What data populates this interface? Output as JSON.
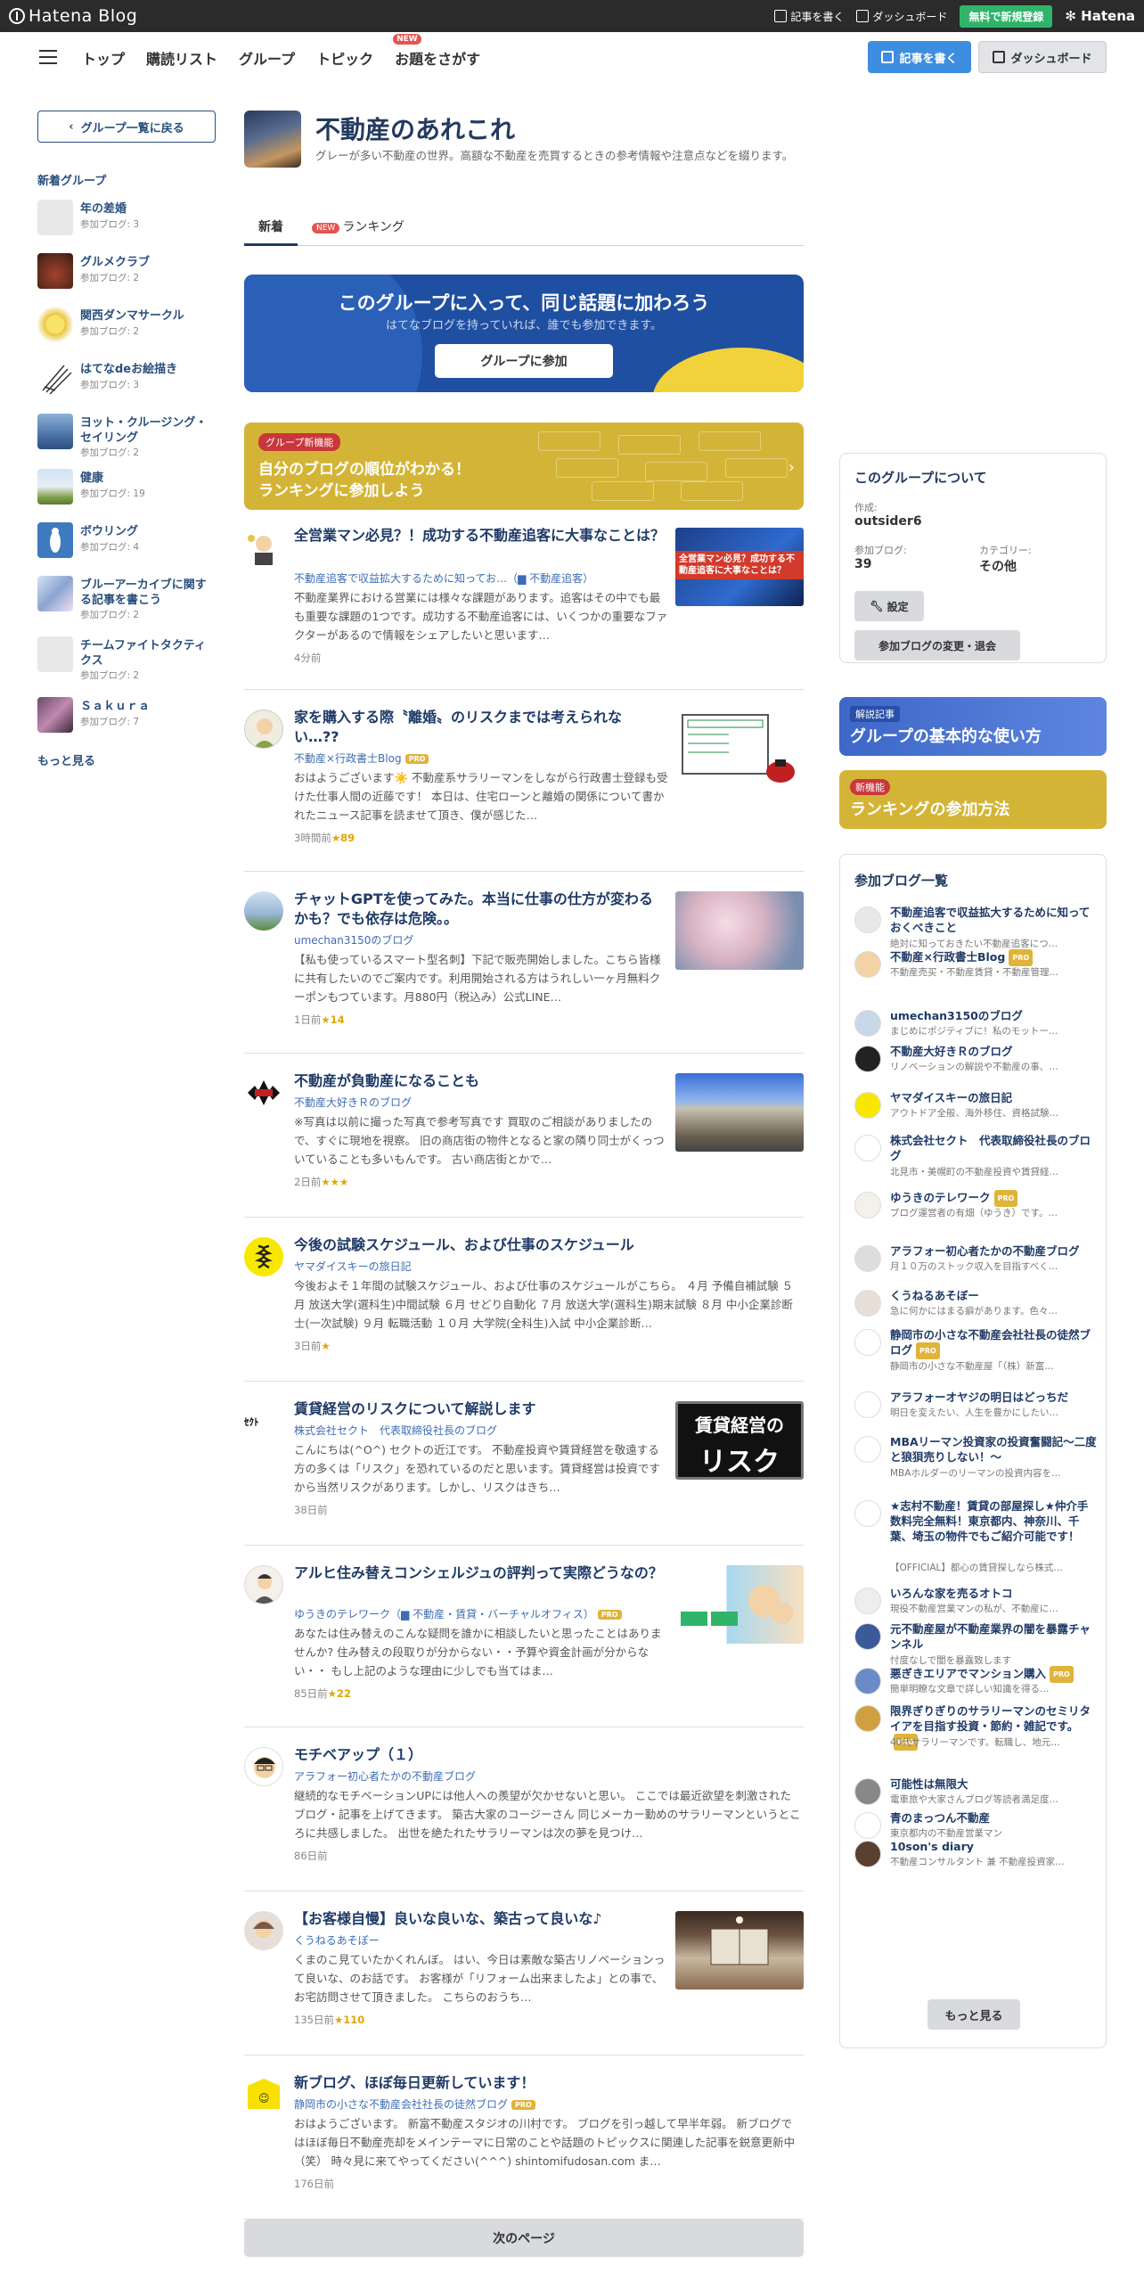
{
  "topbar": {
    "logo": "Hatena Blog",
    "write": "記事を書く",
    "dashboard": "ダッシュボード",
    "signup": "無料で新規登録",
    "hatena": "Hatena"
  },
  "nav": {
    "items": [
      "トップ",
      "購読リスト",
      "グループ",
      "トピック",
      "お題をさがす"
    ],
    "new_badge": "NEW",
    "write_button": "記事を書く",
    "dashboard_button": "ダッシュボード"
  },
  "left": {
    "back": "グループ一覧に戻る",
    "heading": "新着グループ",
    "count_prefix": "参加ブログ: ",
    "more": "もっと見る",
    "groups": [
      {
        "name": "年の差婚",
        "count": "3"
      },
      {
        "name": "グルメクラブ",
        "count": "2"
      },
      {
        "name": "関西ダンマサークル",
        "count": "2"
      },
      {
        "name": "はてなdeお絵描き",
        "count": "3"
      },
      {
        "name": "ヨット・クルージング・セイリング",
        "count": "2"
      },
      {
        "name": "健康",
        "count": "19"
      },
      {
        "name": "ボウリング",
        "count": "4"
      },
      {
        "name": "ブルーアーカイブに関する記事を書こう",
        "count": "2"
      },
      {
        "name": "チームファイトタクティクス",
        "count": "2"
      },
      {
        "name": "Ｓａｋｕｒａ",
        "count": "7"
      }
    ]
  },
  "group": {
    "title": "不動産のあれこれ",
    "description": "グレーが多い不動産の世界。高額な不動産を売買するときの参考情報や注意点などを綴ります。"
  },
  "tabs": {
    "latest": "新着",
    "new_badge": "NEW",
    "ranking": "ランキング"
  },
  "join_banner": {
    "title": "このグループに入って、同じ話題に加わろう",
    "subtitle": "はてなブログを持っていれば、誰でも参加できます。",
    "button": "グループに参加"
  },
  "rank_banner": {
    "badge": "グループ新機能",
    "line1": "自分のブログの順位がわかる！",
    "line2": "ランキングに参加しよう"
  },
  "entries": [
    {
      "title": "全営業マン必見？！成功する不動産追客に大事なことは？",
      "blog": "不動産追客で収益拡大するために知ってお…",
      "cat": "不動産追客",
      "pro": false,
      "excerpt": "不動産業界における営業には様々な課題があります。追客はその中でも最も重要な課題の1つです。成功する不動産追客には、いくつかの重要なファクターがあるので情報をシェアしたいと思います…",
      "date": "4分前",
      "stars": ""
    },
    {
      "title": "家を購入する際〝離婚〟のリスクまでは考えられない…??",
      "blog": "不動産×行政書士Blog",
      "cat": "",
      "pro": true,
      "excerpt": "おはようございます☀️ 不動産系サラリーマンをしながら行政書士登録も受けた仕事人間の近藤です！ 本日は、住宅ローンと離婚の関係について書かれたニュース記事を読ませて頂き、僕が感じた…",
      "date": "3時間前",
      "stars": "★89"
    },
    {
      "title": "チャットGPTを使ってみた。本当に仕事の仕方が変わるかも？でも依存は危険。。",
      "blog": "umechan3150のブログ",
      "cat": "",
      "pro": false,
      "excerpt": "【私も使っているスマート型名刺】下記で販売開始しました。こちら皆様に共有したいのでご案内です。利用開始される方はうれしい一ヶ月無料クーポンもつています。月880円（税込み）公式LINE…",
      "date": "1日前",
      "stars": "★14"
    },
    {
      "title": "不動産が負動産になることも",
      "blog": "不動産大好きＲのブログ",
      "cat": "",
      "pro": false,
      "excerpt": "※写真は以前に撮った写真で参考写真です 買取のご相談がありましたので、すぐに現地を視察。 旧の商店街の物件となると家の隣り同士がくっついていることも多いもんです。 古い商店街とかで…",
      "date": "2日前",
      "stars": "★★★"
    },
    {
      "title": "今後の試験スケジュール、および仕事のスケジュール",
      "blog": "ヤマダイスキーの旅日記",
      "cat": "",
      "pro": false,
      "excerpt": "今後およそ１年間の試験スケジュール、および仕事のスケジュールがこちら。 ４月 予備自補試験 ５月 放送大学(選科生)中間試験 ６月 せどり自動化 ７月 放送大学(選科生)期末試験 ８月 中小企業診断士(一次試験) ９月 転職活動 １０月 大学院(全科生)入試 中小企業診断…",
      "date": "3日前",
      "stars": "★"
    },
    {
      "title": "賃貸経営のリスクについて解説します",
      "blog": "株式会社セクト　代表取締役社長のブログ",
      "cat": "",
      "pro": false,
      "excerpt": "こんにちは(^O^) セクトの近江です。 不動産投資や賃貸経営を敬遠する方の多くは「リスク」を恐れているのだと思います。賃貸経営は投資ですから当然リスクがあります。しかし、リスクはきち…",
      "date": "38日前",
      "stars": ""
    },
    {
      "title": "アルヒ住み替えコンシェルジュの評判って実際どうなの？",
      "blog": "ゆうきのテレワーク（",
      "cat": "不動産・賃貸・バーチャルオフィス",
      "pro": true,
      "excerpt": "あなたは住み替えのこんな疑問を誰かに相談したいと思ったことはありませんか? 住み替えの段取りが分からない・・予算や資金計画が分からない・・ もし上記のような理由に少しでも当てはま…",
      "date": "85日前",
      "stars": "★22"
    },
    {
      "title": "モチベアップ（１）",
      "blog": "アラフォー初心者たかの不動産ブログ",
      "cat": "",
      "pro": false,
      "excerpt": "継続的なモチベーションUPには他人への羨望が欠かせないと思い。 ここでは最近欲望を刺激されたブログ・記事を上げてきます。 築古大家のコージーさん 同じメーカー勤めのサラリーマンというところに共感しました。 出世を絶たれたサラリーマンは次の夢を見つけ…",
      "date": "86日前",
      "stars": ""
    },
    {
      "title": "【お客様自慢】良いな良いな、築古って良いな♪",
      "blog": "くうねるあそぼー",
      "cat": "",
      "pro": false,
      "excerpt": "くまのこ見ていたかくれんぼ。 はい、今日は素敵な築古リノベーションって良いな、のお話です。 お客様が「リフォーム出来ましたよ」との事で、 お宅訪問させて頂きました。 こちらのおうち…",
      "date": "135日前",
      "stars": "★110"
    },
    {
      "title": "新ブログ、ほぼ毎日更新しています！",
      "blog": "静岡市の小さな不動産会社社長の徒然ブログ",
      "cat": "",
      "pro": true,
      "excerpt": "おはようございます。 新富不動産スタジオの川村です。 ブログを引っ越して早半年弱。 新ブログではほぼ毎日不動産売却をメインテーマに日常のことや話題のトピックスに関連した記事を鋭意更新中（笑） 時々見に来てやってください(^^^) shintomifudosan.com ま…",
      "date": "176日前",
      "stars": ""
    }
  ],
  "img_text": {
    "e1": "全営業マン必見？成功する不動産追客に大事なことは？",
    "e6": [
      "賃貸経営の",
      "リスク"
    ]
  },
  "next_page": "次のページ",
  "about": {
    "heading": "このグループについて",
    "author_label": "作成:",
    "author": "outsider6",
    "blogs_label": "参加ブログ:",
    "blogs": "39",
    "category_label": "カテゴリー:",
    "category": "その他",
    "settings": "設定",
    "change": "参加ブログの変更・退会"
  },
  "guide_banner": {
    "badge": "解説記事",
    "title": "グループの基本的な使い方"
  },
  "rank_side_banner": {
    "badge": "新機能",
    "title": "ランキングの参加方法"
  },
  "member_blogs": {
    "heading": "参加ブログ一覧",
    "more": "もっと見る",
    "items": [
      {
        "name": "不動産追客で収益拡大するために知っておくべきこと",
        "desc": "絶対に知っておきたい不動産追客につ…",
        "pro": false
      },
      {
        "name": "不動産×行政書士Blog",
        "desc": "不動産売买・不動産賃貸・不動産管理…",
        "pro": true
      },
      {
        "name": "umechan3150のブログ",
        "desc": "まじめにポジティブに！私のモットー…",
        "pro": false
      },
      {
        "name": "不動産大好きＲのブログ",
        "desc": "リノベーションの解説や不動産の事、…",
        "pro": false
      },
      {
        "name": "ヤマダイスキーの旅日記",
        "desc": "アウトドア全般、海外移住、資格試験…",
        "pro": false
      },
      {
        "name": "株式会社セクト　代表取締役社長のブログ",
        "desc": "北見市・美幌町の不動産投資や賃貸経…",
        "pro": false
      },
      {
        "name": "ゆうきのテレワーク",
        "desc": "ブログ運営者の有畑（ゆうき）です。…",
        "pro": true
      },
      {
        "name": "アラフォー初心者たかの不動産ブログ",
        "desc": "月１０万のストック収入を目指すべく…",
        "pro": false
      },
      {
        "name": "くうねるあそぼー",
        "desc": "急に何かにはまる癖があります。色々…",
        "pro": false
      },
      {
        "name": "静岡市の小さな不動産会社社長の徒然ブログ",
        "desc": "静岡市の小さな不動産屋「（株）新富…",
        "pro": true
      },
      {
        "name": "アラフォーオヤジの明日はどっちだ",
        "desc": "明日を変えたい、人生を豊かにしたい…",
        "pro": false
      },
      {
        "name": "MBAリーマン投資家の投資奮闘記～二度と狼狽売りしない！～",
        "desc": "MBAホルダーのリーマンの投資内容を…",
        "pro": false
      },
      {
        "name": "★志村不動産！賃貸の部屋探し★仲介手数料完全無料！東京都内、神奈川、千葉、埼玉の物件でもご紹介可能です！",
        "desc": "【OFFICIAL】都心の賃貸探しなら株式…",
        "pro": false
      },
      {
        "name": "いろんな家を売るオトコ",
        "desc": "現役不動産営業マンの私が、不動産に…",
        "pro": false
      },
      {
        "name": "元不動産屋が不動産業界の闇を暴露チャンネル",
        "desc": "忖度なしで闇を暴露致します",
        "pro": false
      },
      {
        "name": "悪ぎきエリアでマンション購入",
        "desc": "簡単明瞭な文章で詳しい知識を得る…",
        "pro": true
      },
      {
        "name": "限界ぎりぎりのサラリーマンのセミリタイアを目指す投資・節約・雑記です。",
        "desc": "40代サラリーマンです。転職し、地元…",
        "pro": true
      },
      {
        "name": "可能性は無限大",
        "desc": "電車旅や大家さんブログ等読者満足度…",
        "pro": false
      },
      {
        "name": "青のまっつん不動産",
        "desc": "東京都内の不動産営業マン",
        "pro": false
      },
      {
        "name": "10son's diary",
        "desc": "不動産コンサルタント 兼 不動産投資家…",
        "pro": false
      }
    ]
  },
  "colors": {
    "accent": "#3d8de0",
    "navy": "#233a5f",
    "join_banner": "#1f4fa0",
    "rank_banner": "#d4b436",
    "signup": "#2fb46a",
    "new": "#e35550"
  }
}
